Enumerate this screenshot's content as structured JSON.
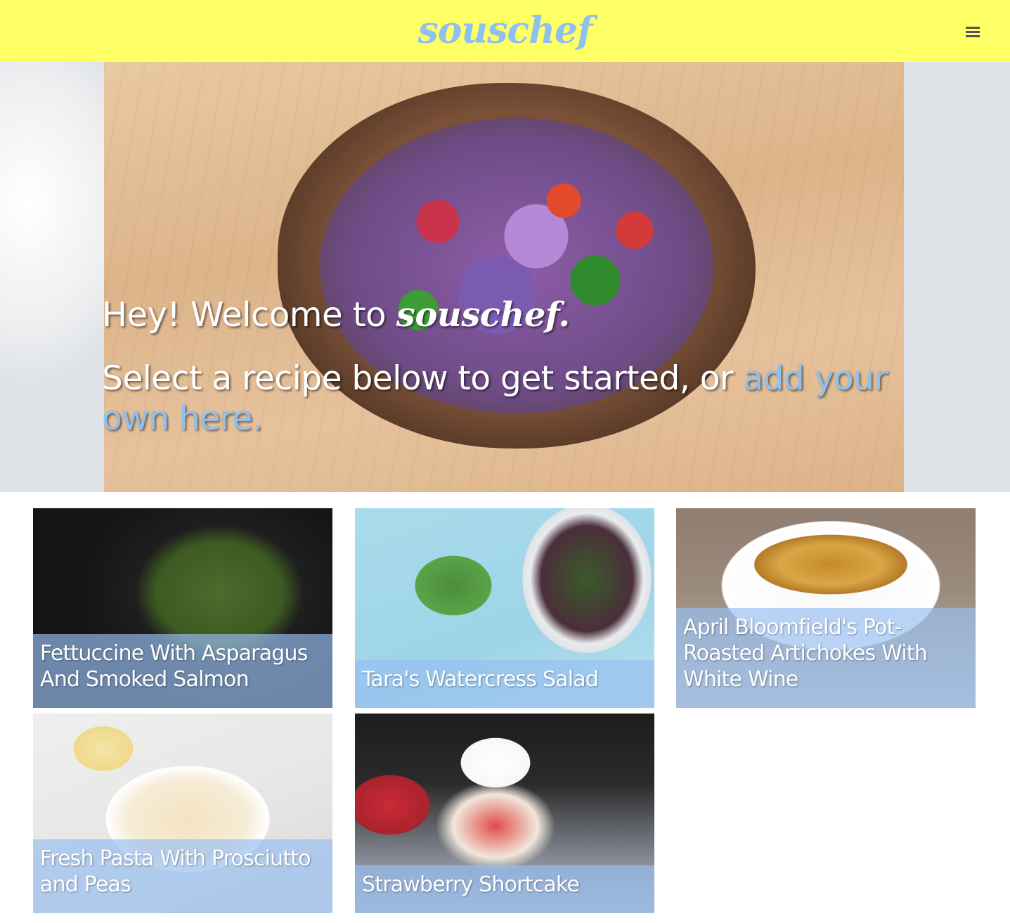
{
  "header": {
    "logo": "souschef",
    "menu_icon": "hamburger-menu-icon"
  },
  "hero": {
    "greeting": "Hey! Welcome to ",
    "brand": "souschef",
    "brand_suffix": ".",
    "subtitle": "Select a recipe below to get started, or ",
    "link_text": "add your own here."
  },
  "recipes": [
    {
      "title": "Fettuccine With Asparagus And Smoked Salmon"
    },
    {
      "title": "Tara's Watercress Salad"
    },
    {
      "title": "April Bloomfield's Pot-Roasted Artichokes With White Wine"
    },
    {
      "title": "Fresh Pasta With Prosciutto and Peas"
    },
    {
      "title": "Strawberry Shortcake"
    }
  ],
  "colors": {
    "header_bg": "#ffff66",
    "brand_blue": "#8ec1ef",
    "caption_overlay": "#96bef0"
  }
}
